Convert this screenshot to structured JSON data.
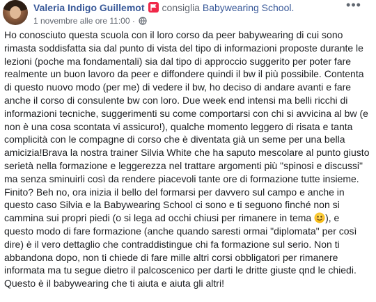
{
  "post": {
    "author_name": "Valeria Indigo Guillemot",
    "action_text": "consiglia",
    "page_name": "Babywearing School.",
    "timestamp": "1 novembre alle ore 11:00",
    "separator": "·",
    "more_label": "•••",
    "icons": {
      "recommend": "recommend-flag-icon",
      "privacy": "globe-icon",
      "more": "more-options-icon",
      "emoji": "smiling-face-emoji"
    },
    "colors": {
      "link": "#385898",
      "recommend_badge": "#f02849",
      "secondary_text": "#616770",
      "body_text": "#1c1e21"
    },
    "body_part1": "Ho conosciuto questa scuola con il loro corso da peer babywearing di cui sono\nrimasta soddisfatta sia dal punto di vista del tipo di informazioni proposte durante le\nlezioni (poche ma fondamentali) sia dal tipo di approccio suggerito per poter fare\nrealmente un buon lavoro da peer e diffondere quindi il bw il più possibile. Contenta\ndi questo nuovo modo (per me) di vedere il bw, ho deciso di andare avanti e fare\nanche il corso di consulente bw con loro. Due week end intensi ma belli ricchi di\ninformazioni tecniche, suggerimenti su come comportarsi con chi si avvicina al bw (e\nnon è una cosa scontata vi assicuro!), qualche momento leggero di risata e tanta\ncomplicità con le compagne di corso che è diventata già un seme per una bella\namicizia!Brava la nostra trainer Silvia White che ha saputo mescolare al punto giusto\nserietà nella formazione e leggerezza nel trattare argomenti più \"spinosi e discussi\"\nma senza sminuirli così da rendere piacevoli tante ore di formazione tutte insieme.\nFinito? Beh no, ora inizia il bello del formarsi per davvero sul campo e anche in\nquesto caso Silvia e la Babywearing School ci sono e ti seguono finché non si\ncammina sui propri piedi (o si lega ad occhi chiusi per rimanere in tema ",
    "body_part2": "), e\nquesto modo di fare formazione (anche quando saresti ormai \"diplomata\" per così\ndire) è il vero dettaglio che contraddistingue chi fa formazione sul serio. Non ti\nabbandona dopo, non ti chiede di fare mille altri corsi obbligatori per rimanere\ninformata ma tu segue dietro il palcoscenico per darti le dritte giuste qnd le chiedi.\nQuesto è il babywearing che ti aiuta e aiuta gli altri!"
  }
}
